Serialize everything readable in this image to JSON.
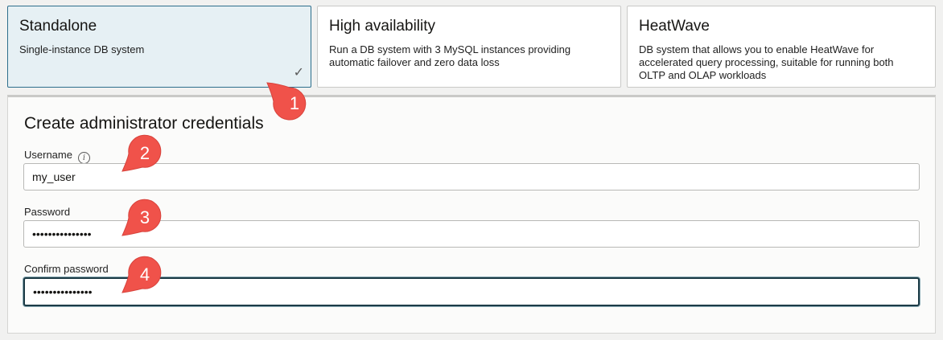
{
  "options": [
    {
      "title": "Standalone",
      "desc": "Single-instance DB system",
      "selected": true
    },
    {
      "title": "High availability",
      "desc": "Run a DB system with 3 MySQL instances providing automatic failover and zero data loss",
      "selected": false
    },
    {
      "title": "HeatWave",
      "desc": "DB system that allows you to enable HeatWave for accelerated query processing, suitable for running both OLTP and OLAP workloads",
      "selected": false
    }
  ],
  "check_icon": "✓",
  "credentials": {
    "title": "Create administrator credentials",
    "username_label": "Username",
    "username_value": "my_user",
    "info_icon": "i",
    "password_label": "Password",
    "password_value": "•••••••••••••••",
    "confirm_label": "Confirm password",
    "confirm_value": "•••••••••••••••"
  },
  "markers": [
    "1",
    "2",
    "3",
    "4"
  ],
  "colors": {
    "marker": "#f0524a",
    "selected_bg": "#e6f0f4",
    "selected_border": "#2d6e8c",
    "focus_border": "#1c3b46"
  }
}
